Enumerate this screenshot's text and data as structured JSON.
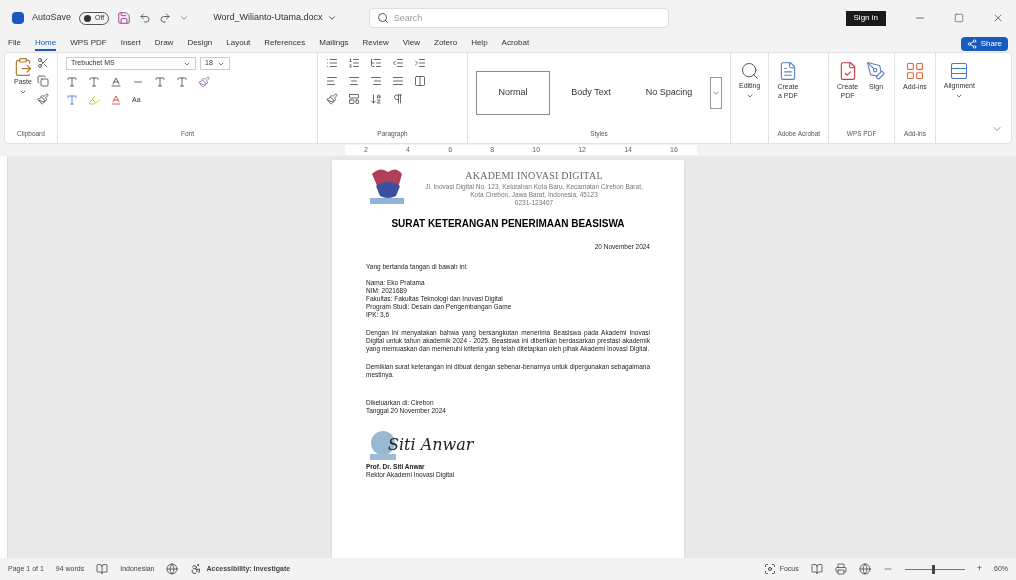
{
  "title_bar": {
    "autosave_label": "AutoSave",
    "autosave_toggle": {
      "label": "Off",
      "on": false
    },
    "file_name": "Word_Wilianto-Utama.docx",
    "search": {
      "placeholder": "Search"
    },
    "sign_in": "Sign in"
  },
  "tabs": [
    {
      "label": "File",
      "selected": false
    },
    {
      "label": "Home",
      "selected": true
    },
    {
      "label": "WPS PDF",
      "selected": false
    },
    {
      "label": "Insert",
      "selected": false
    },
    {
      "label": "Draw",
      "selected": false
    },
    {
      "label": "Design",
      "selected": false
    },
    {
      "label": "Layout",
      "selected": false
    },
    {
      "label": "References",
      "selected": false
    },
    {
      "label": "Mailings",
      "selected": false
    },
    {
      "label": "Review",
      "selected": false
    },
    {
      "label": "View",
      "selected": false
    },
    {
      "label": "Zotero",
      "selected": false
    },
    {
      "label": "Help",
      "selected": false
    },
    {
      "label": "Acrobat",
      "selected": false
    }
  ],
  "share": "Share",
  "ribbon": {
    "clipboard": {
      "paste": "Paste",
      "label": "Clipboard"
    },
    "font": {
      "name": "Trebuchet MS",
      "size": "18",
      "label": "Font",
      "change_case": "Aa"
    },
    "paragraph": {
      "label": "Paragraph"
    },
    "styles": {
      "items": [
        {
          "label": "Normal",
          "selected": true
        },
        {
          "label": "Body Text",
          "selected": false
        },
        {
          "label": "No Spacing",
          "selected": false
        }
      ],
      "label": "Styles"
    },
    "editing": "Editing",
    "groups": [
      {
        "label": "Adobe Acrobat",
        "buttons": [
          "Create\na PDF"
        ]
      },
      {
        "label": "WPS PDF",
        "buttons": [
          "Create\nPDF",
          "Sign"
        ]
      },
      {
        "label": "Add-ins",
        "buttons": [
          "Add-ins"
        ]
      }
    ],
    "alignment": "Alignment"
  },
  "ruler": [
    "2",
    "4",
    "6",
    "8",
    "10",
    "12",
    "14",
    "16"
  ],
  "document": {
    "institution": "AKADEMI INOVASI DIGITAL",
    "address": [
      "Jl. Inovasi Digital No. 123, Kelurahan Kota Baru, Kecamatan Cirebon Barat,",
      "Kota Cirebon, Jawa Barat, Indonesia, 45123",
      "0231-123467"
    ],
    "title": "SURAT KETERANGAN PENERIMAAN BEASISWA",
    "date": "20 November 2024",
    "intro": "Yang bertanda tangan di bawah ini:",
    "fields": [
      "Nama: Eko Pratama",
      "NIM: 2021689",
      "Fakultas: Fakultas Teknologi dan Inovasi Digital",
      "Program Studi: Desain dan Pengembangan Game",
      "IPK: 3,6"
    ],
    "paragraphs": [
      "Dengan ini menyatakan bahwa yang bersangkutan menerima Beasiswa pada Akademi Inovasi Digital untuk tahun akademik 2024 - 2025. Beasiswa ini diberikan berdasarkan prestasi akademik yang memuaskan dan memenuhi kriteria yang telah ditetapkan oleh pihak Akademi Inovasi Digital.",
      "Demikian surat keterangan ini dibuat dengan sebenar-benarnya untuk dipergunakan sebagaimana mestinya."
    ],
    "issued": [
      "Dikeluarkan di: Cirebon",
      "Tanggal 20 November 2024"
    ],
    "signature": "Siti Anwar",
    "signer": [
      "Prof. Dr. Siti Anwar",
      "Rektor Akademi Inovasi Digital"
    ]
  },
  "status_bar": {
    "page": "Page 1 of 1",
    "words": "94 words",
    "language": "Indonesian",
    "accessibility": "Accessibility: Investigate",
    "focus": "Focus",
    "zoom": {
      "level": 0.45
    },
    "zoom_in": "+",
    "zoom_reading": "60%"
  }
}
